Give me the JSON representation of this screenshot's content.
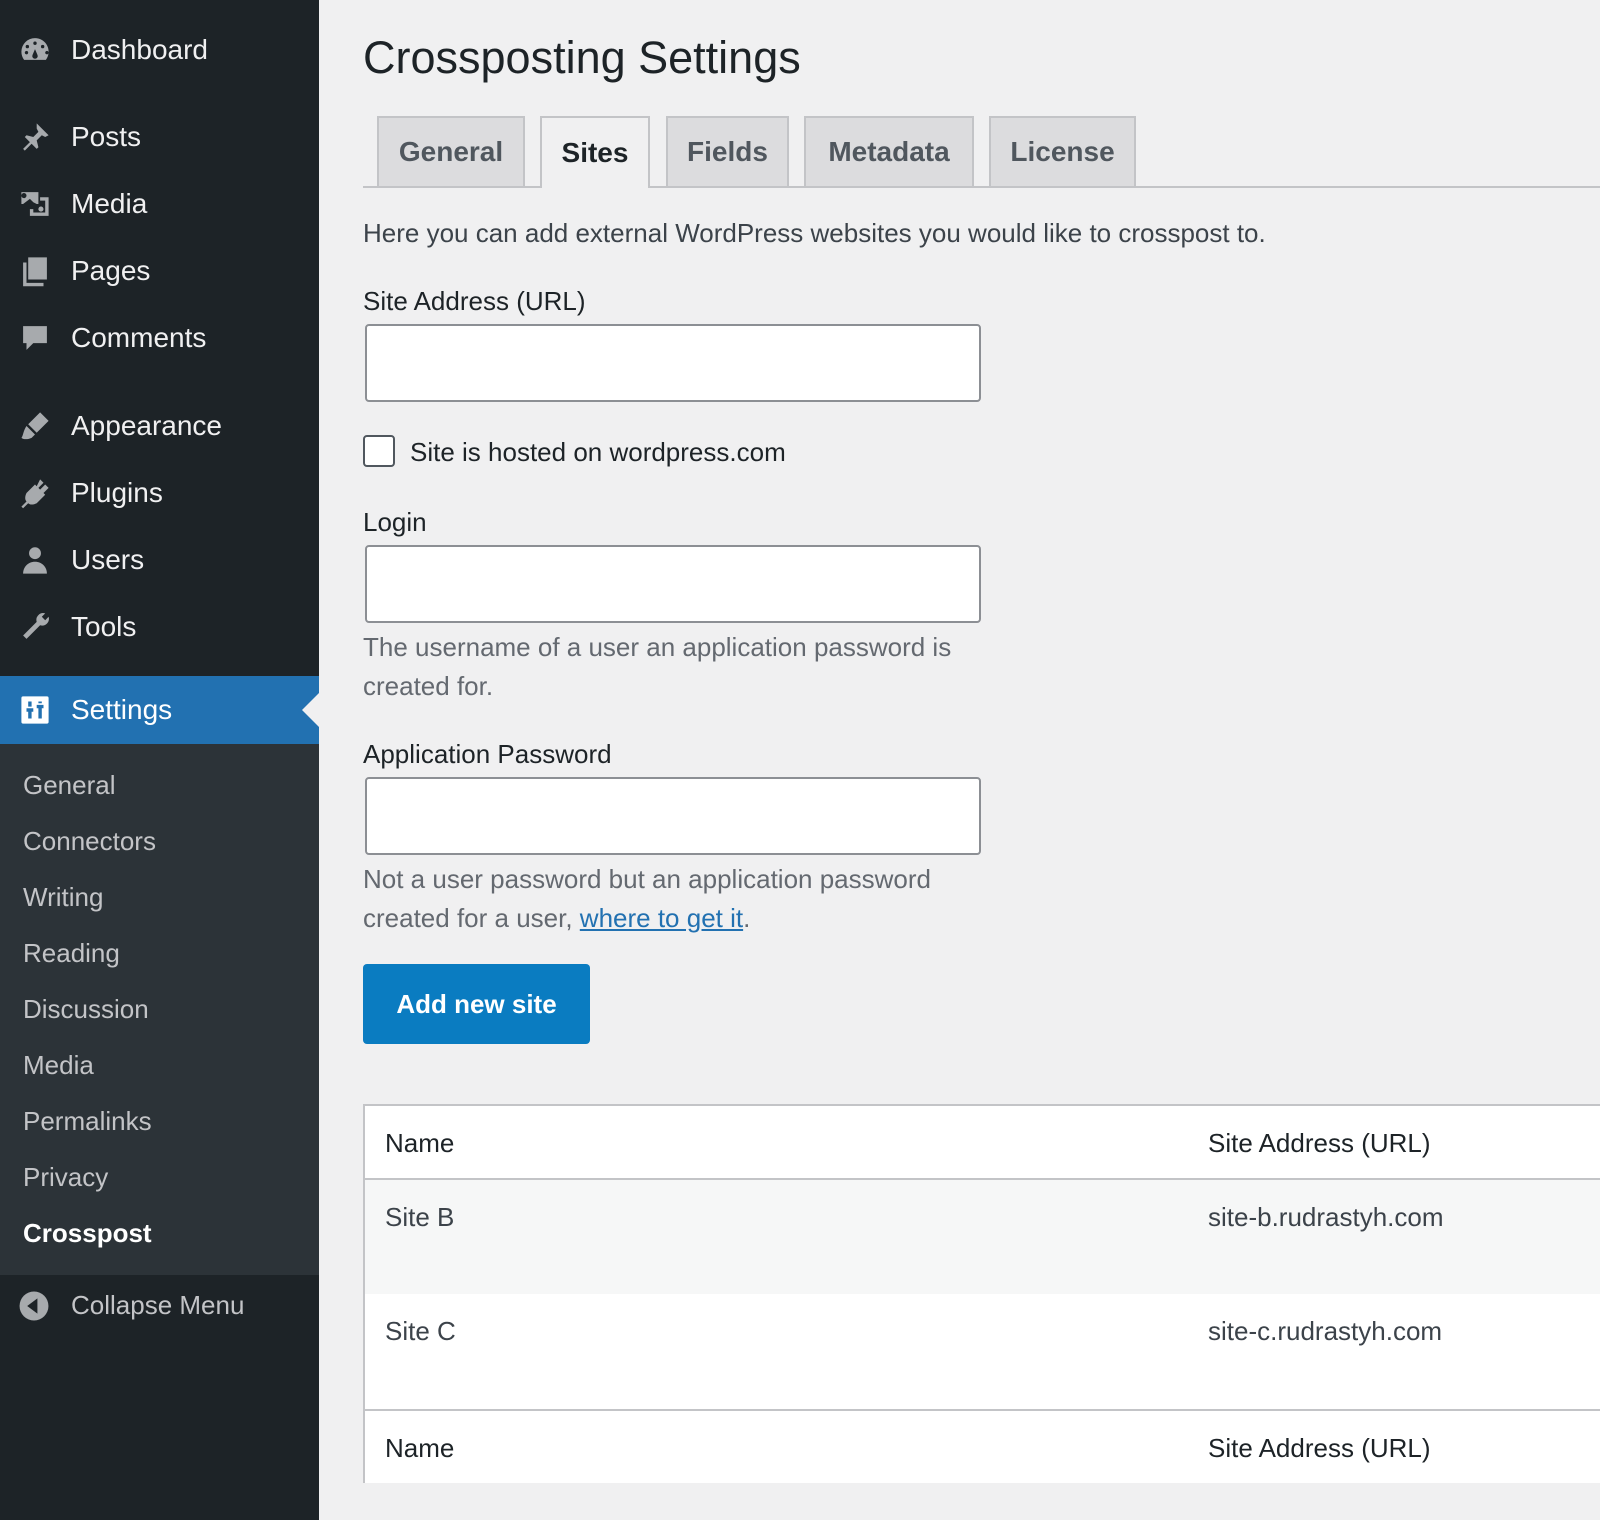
{
  "sidebar": {
    "items": [
      {
        "label": "Dashboard",
        "icon": "dashboard-icon"
      },
      {
        "label": "Posts",
        "icon": "pin-icon"
      },
      {
        "label": "Media",
        "icon": "media-icon"
      },
      {
        "label": "Pages",
        "icon": "pages-icon"
      },
      {
        "label": "Comments",
        "icon": "comment-icon"
      },
      {
        "label": "Appearance",
        "icon": "brush-icon"
      },
      {
        "label": "Plugins",
        "icon": "plugin-icon"
      },
      {
        "label": "Users",
        "icon": "user-icon"
      },
      {
        "label": "Tools",
        "icon": "wrench-icon"
      },
      {
        "label": "Settings",
        "icon": "settings-icon"
      }
    ],
    "submenu": [
      "General",
      "Connectors",
      "Writing",
      "Reading",
      "Discussion",
      "Media",
      "Permalinks",
      "Privacy",
      "Crosspost"
    ],
    "collapse_label": "Collapse Menu"
  },
  "page": {
    "title": "Crossposting Settings",
    "tabs": [
      "General",
      "Sites",
      "Fields",
      "Metadata",
      "License"
    ],
    "active_tab": "Sites",
    "intro": "Here you can add external WordPress websites you would like to crosspost to.",
    "form": {
      "url_label": "Site Address (URL)",
      "url_value": "",
      "wpcom_label": "Site is hosted on wordpress.com",
      "wpcom_checked": false,
      "login_label": "Login",
      "login_value": "",
      "login_help": "The username of a user an application password is created for.",
      "password_label": "Application Password",
      "password_value": "",
      "password_help_prefix": "Not a user password but an application password created for a user, ",
      "password_help_link": "where to get it",
      "password_help_suffix": ".",
      "submit_label": "Add new site"
    },
    "table": {
      "columns": [
        "Name",
        "Site Address (URL)"
      ],
      "rows": [
        {
          "name": "Site B",
          "url": "site-b.rudrastyh.com"
        },
        {
          "name": "Site C",
          "url": "site-c.rudrastyh.com"
        }
      ]
    }
  },
  "colors": {
    "sidebar_bg": "#1d2327",
    "submenu_bg": "#2c3338",
    "accent": "#2271b1",
    "button": "#0a7cc1",
    "page_bg": "#f0f0f1"
  }
}
